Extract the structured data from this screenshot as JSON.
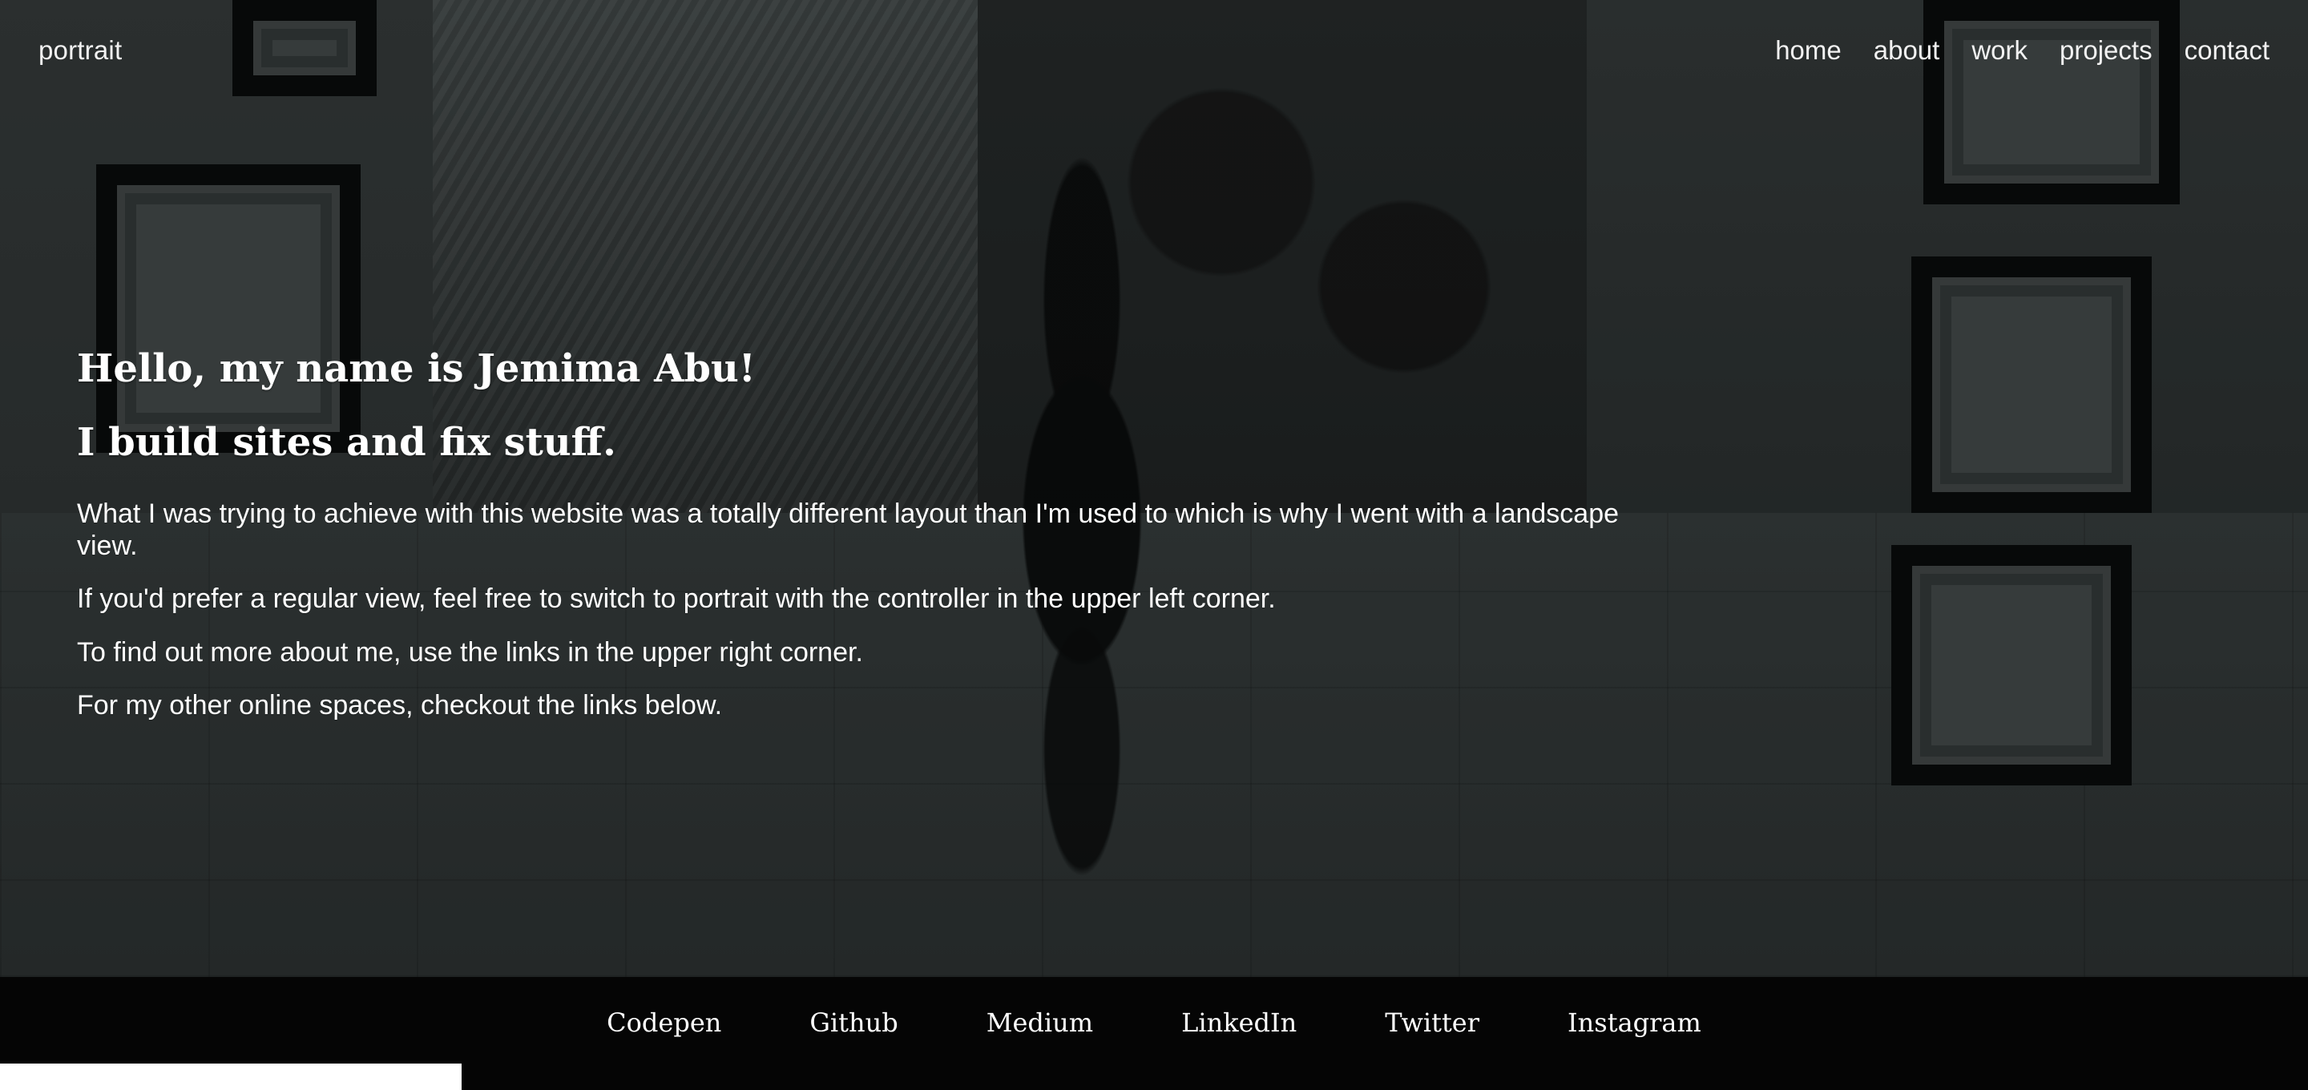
{
  "top_left": {
    "portrait_link": "portrait"
  },
  "nav": {
    "items": [
      {
        "label": "home"
      },
      {
        "label": "about"
      },
      {
        "label": "work"
      },
      {
        "label": "projects"
      },
      {
        "label": "contact"
      }
    ]
  },
  "intro": {
    "heading_1": "Hello, my name is Jemima Abu!",
    "heading_2": "I build sites and fix stuff.",
    "paragraphs": [
      "What I was trying to achieve with this website was a totally different layout than I'm used to which is why I went with a landscape view.",
      "If you'd prefer a regular view, feel free to switch to portrait with the controller in the upper left corner.",
      "To find out more about me, use the links in the upper right corner.",
      "For my other online spaces, checkout the links below."
    ]
  },
  "footer": {
    "links": [
      {
        "label": "Codepen"
      },
      {
        "label": "Github"
      },
      {
        "label": "Medium"
      },
      {
        "label": "LinkedIn"
      },
      {
        "label": "Twitter"
      },
      {
        "label": "Instagram"
      }
    ]
  }
}
